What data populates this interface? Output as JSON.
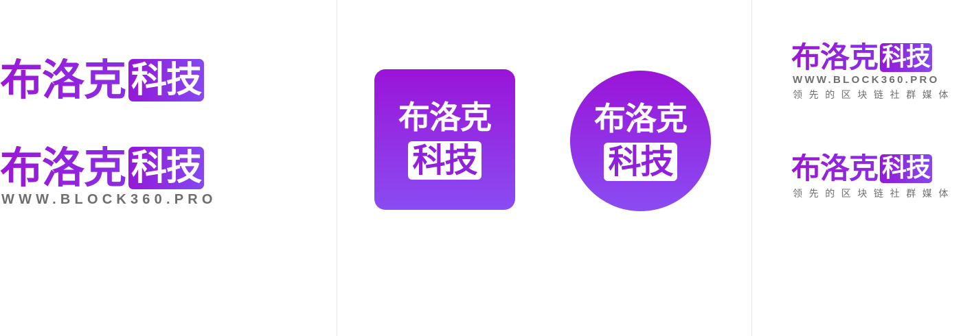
{
  "logo": {
    "brand_name": "布洛克",
    "badge_text": "科技",
    "url": "WWW.BLOCK360.PRO",
    "slogan": "领先的区块链社群媒体"
  },
  "colors": {
    "brand_purple": "#9a18d6",
    "brand_violet": "#8a4cf2",
    "url_gray": "#6e6e6e",
    "background": "#ffffff"
  }
}
